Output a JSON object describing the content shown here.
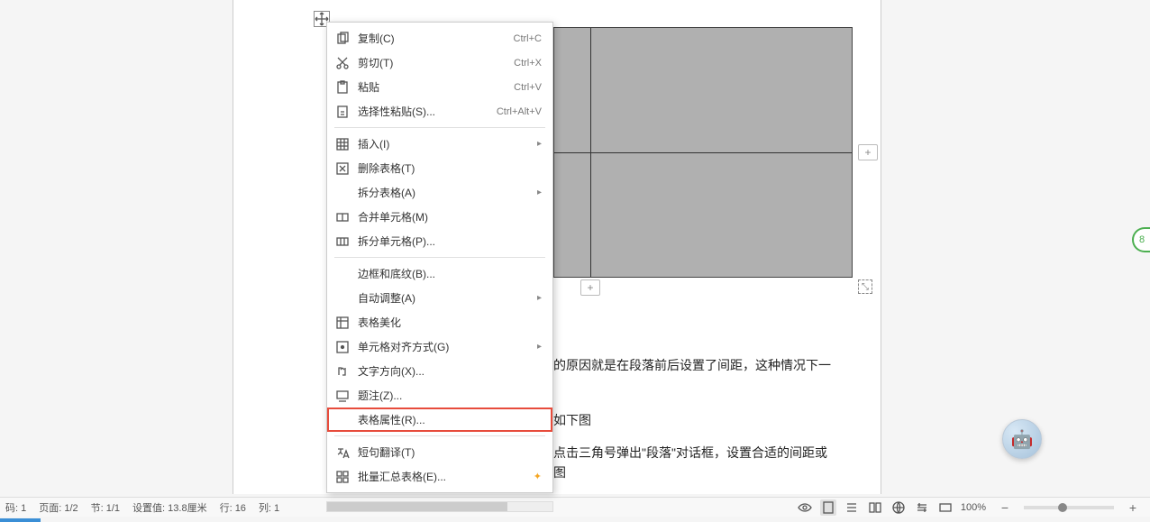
{
  "doc": {
    "text1": "的原因就是在段落前后设置了间距，这种情况下一",
    "text2": "如下图",
    "text3": "点击三角号弹出\"段落\"对话框，设置合适的间距或",
    "text4": "图"
  },
  "menu": {
    "copy": {
      "label": "复制(C)",
      "shortcut": "Ctrl+C"
    },
    "cut": {
      "label": "剪切(T)",
      "shortcut": "Ctrl+X"
    },
    "paste": {
      "label": "粘贴",
      "shortcut": "Ctrl+V"
    },
    "paste_special": {
      "label": "选择性粘贴(S)...",
      "shortcut": "Ctrl+Alt+V"
    },
    "insert": {
      "label": "插入(I)"
    },
    "delete_table": {
      "label": "删除表格(T)"
    },
    "split_table": {
      "label": "拆分表格(A)"
    },
    "merge_cells": {
      "label": "合并单元格(M)"
    },
    "split_cells": {
      "label": "拆分单元格(P)..."
    },
    "borders": {
      "label": "边框和底纹(B)..."
    },
    "autofit": {
      "label": "自动调整(A)"
    },
    "beautify": {
      "label": "表格美化"
    },
    "alignment": {
      "label": "单元格对齐方式(G)"
    },
    "text_direction": {
      "label": "文字方向(X)..."
    },
    "caption": {
      "label": "题注(Z)..."
    },
    "table_properties": {
      "label": "表格属性(R)..."
    },
    "translate": {
      "label": "短句翻译(T)"
    },
    "summary": {
      "label": "批量汇总表格(E)..."
    }
  },
  "status": {
    "page_no": "码: 1",
    "page": "页面: 1/2",
    "section": "节: 1/1",
    "position": "设置值: 13.8厘米",
    "line": "行: 16",
    "column": "列: 1",
    "zoom": "100%"
  },
  "icons": {
    "plus": "+",
    "arrow": "▸",
    "dropdown": "▾",
    "star": "✦",
    "badge": "8"
  }
}
